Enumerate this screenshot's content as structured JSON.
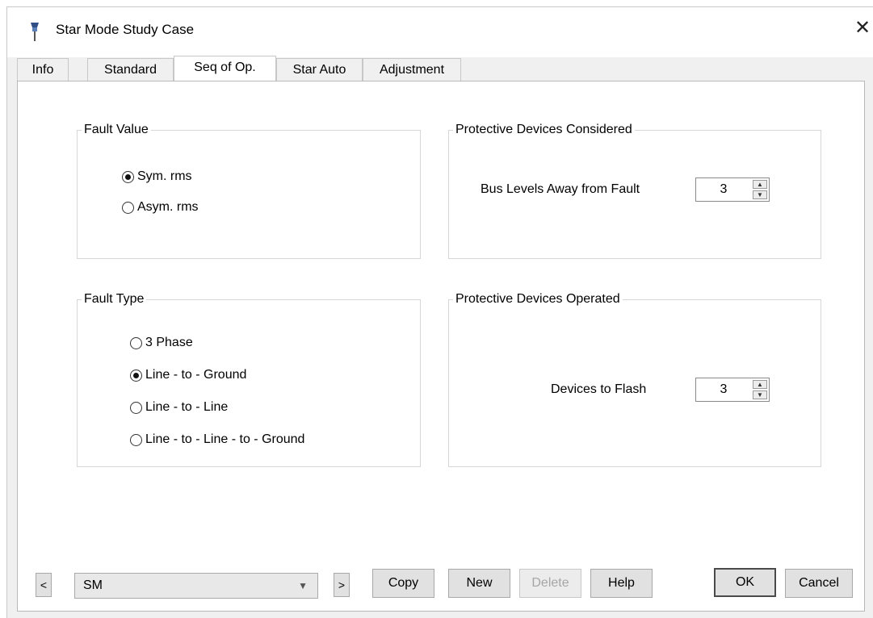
{
  "window": {
    "title": "Star Mode Study Case",
    "close": "✕"
  },
  "tabs": [
    {
      "label": "Info"
    },
    {
      "label": "Standard"
    },
    {
      "label": "Seq of Op."
    },
    {
      "label": "Star Auto"
    },
    {
      "label": "Adjustment"
    }
  ],
  "active_tab": "Seq of Op.",
  "fault_value": {
    "title": "Fault Value",
    "options": [
      {
        "label": "Sym. rms",
        "checked": true
      },
      {
        "label": "Asym. rms",
        "checked": false
      }
    ]
  },
  "fault_type": {
    "title": "Fault Type",
    "options": [
      {
        "label": "3 Phase",
        "checked": false
      },
      {
        "label": "Line - to - Ground",
        "checked": true
      },
      {
        "label": "Line - to - Line",
        "checked": false
      },
      {
        "label": "Line - to - Line - to - Ground",
        "checked": false
      }
    ]
  },
  "devices_considered": {
    "title": "Protective Devices Considered",
    "label": "Bus Levels Away from Fault",
    "value": "3"
  },
  "devices_operated": {
    "title": "Protective Devices Operated",
    "label": "Devices to Flash",
    "value": "3"
  },
  "footer": {
    "prev": "<",
    "next": ">",
    "study_case": "SM",
    "copy": "Copy",
    "new": "New",
    "delete": "Delete",
    "help": "Help",
    "ok": "OK",
    "cancel": "Cancel"
  },
  "icons": {
    "app": "study-case-pin-icon",
    "close": "close-icon",
    "dropdown": "chevron-down-icon"
  }
}
